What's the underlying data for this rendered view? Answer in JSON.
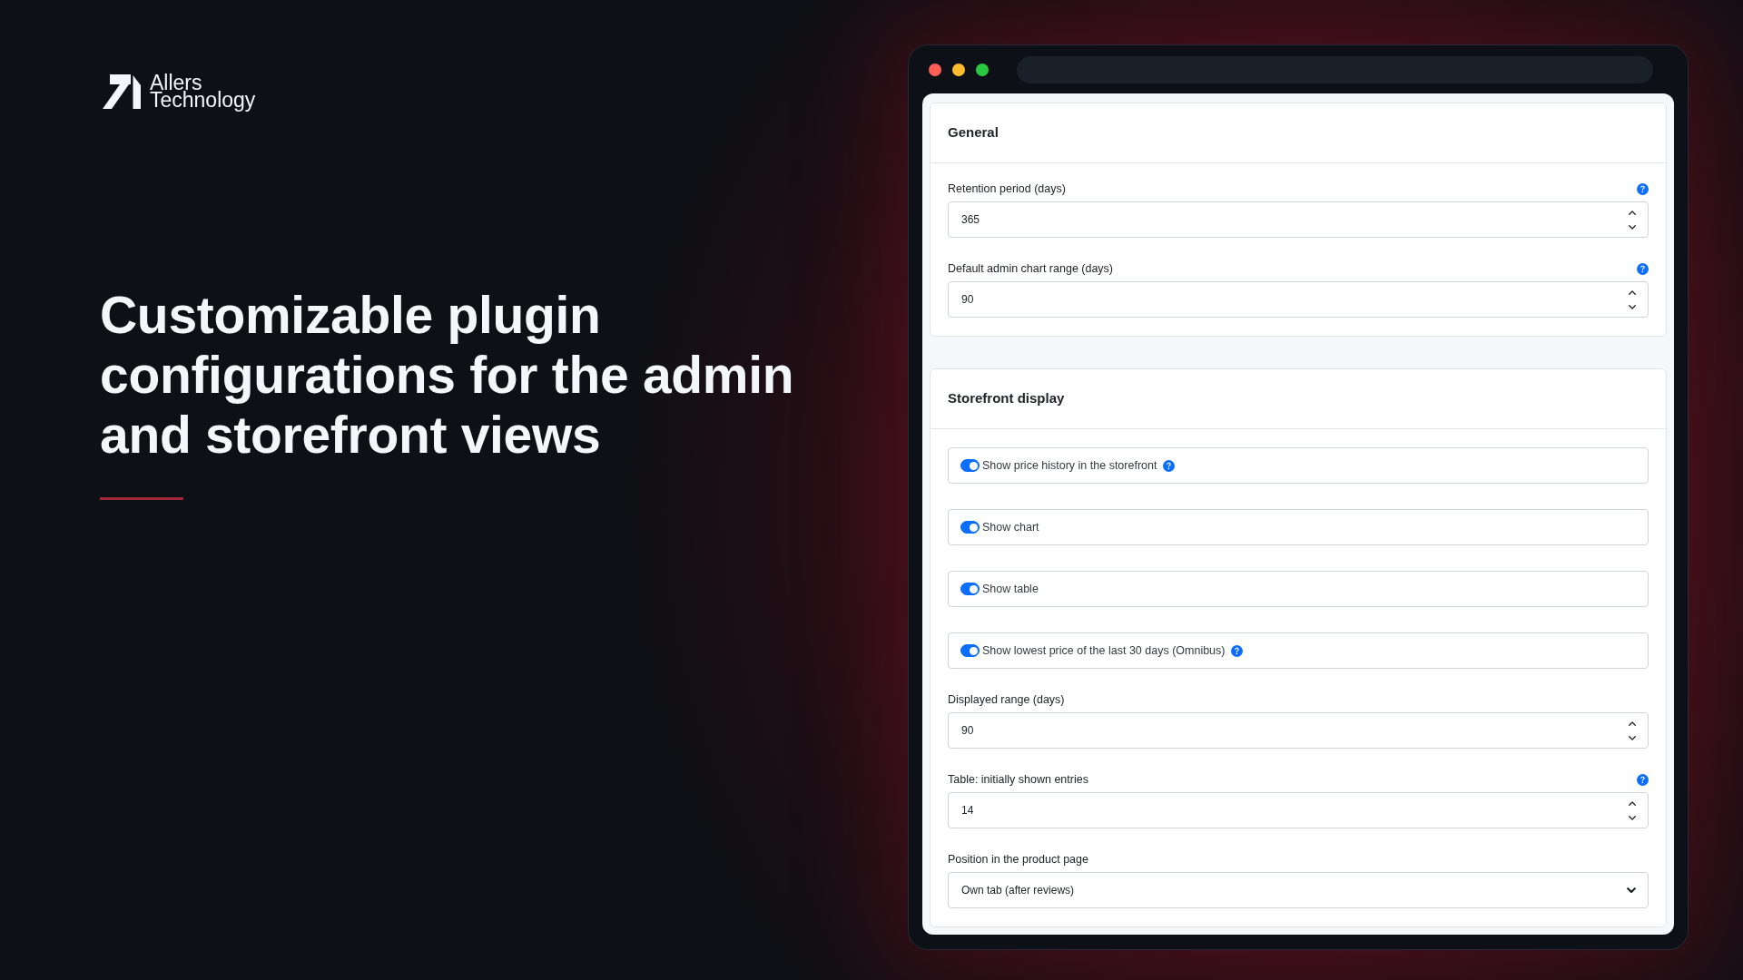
{
  "brand": {
    "name": "Allers Technology"
  },
  "headline": "Customizable plugin configurations for the admin and storefront views",
  "sections": [
    {
      "title": "General",
      "fields": [
        {
          "kind": "number",
          "label": "Retention period (days)",
          "value": "365",
          "help": true
        },
        {
          "kind": "number",
          "label": "Default admin chart range (days)",
          "value": "90",
          "help": true
        }
      ]
    },
    {
      "title": "Storefront display",
      "fields": [
        {
          "kind": "toggle",
          "label": "Show price history in the storefront",
          "on": true,
          "help": true
        },
        {
          "kind": "toggle",
          "label": "Show chart",
          "on": true,
          "help": false
        },
        {
          "kind": "toggle",
          "label": "Show table",
          "on": true,
          "help": false
        },
        {
          "kind": "toggle",
          "label": "Show lowest price of the last 30 days (Omnibus)",
          "on": true,
          "help": true
        },
        {
          "kind": "number",
          "label": "Displayed range (days)",
          "value": "90",
          "help": false
        },
        {
          "kind": "number",
          "label": "Table: initially shown entries",
          "value": "14",
          "help": true
        },
        {
          "kind": "select",
          "label": "Position in the product page",
          "value": "Own tab (after reviews)",
          "help": false
        }
      ]
    }
  ]
}
